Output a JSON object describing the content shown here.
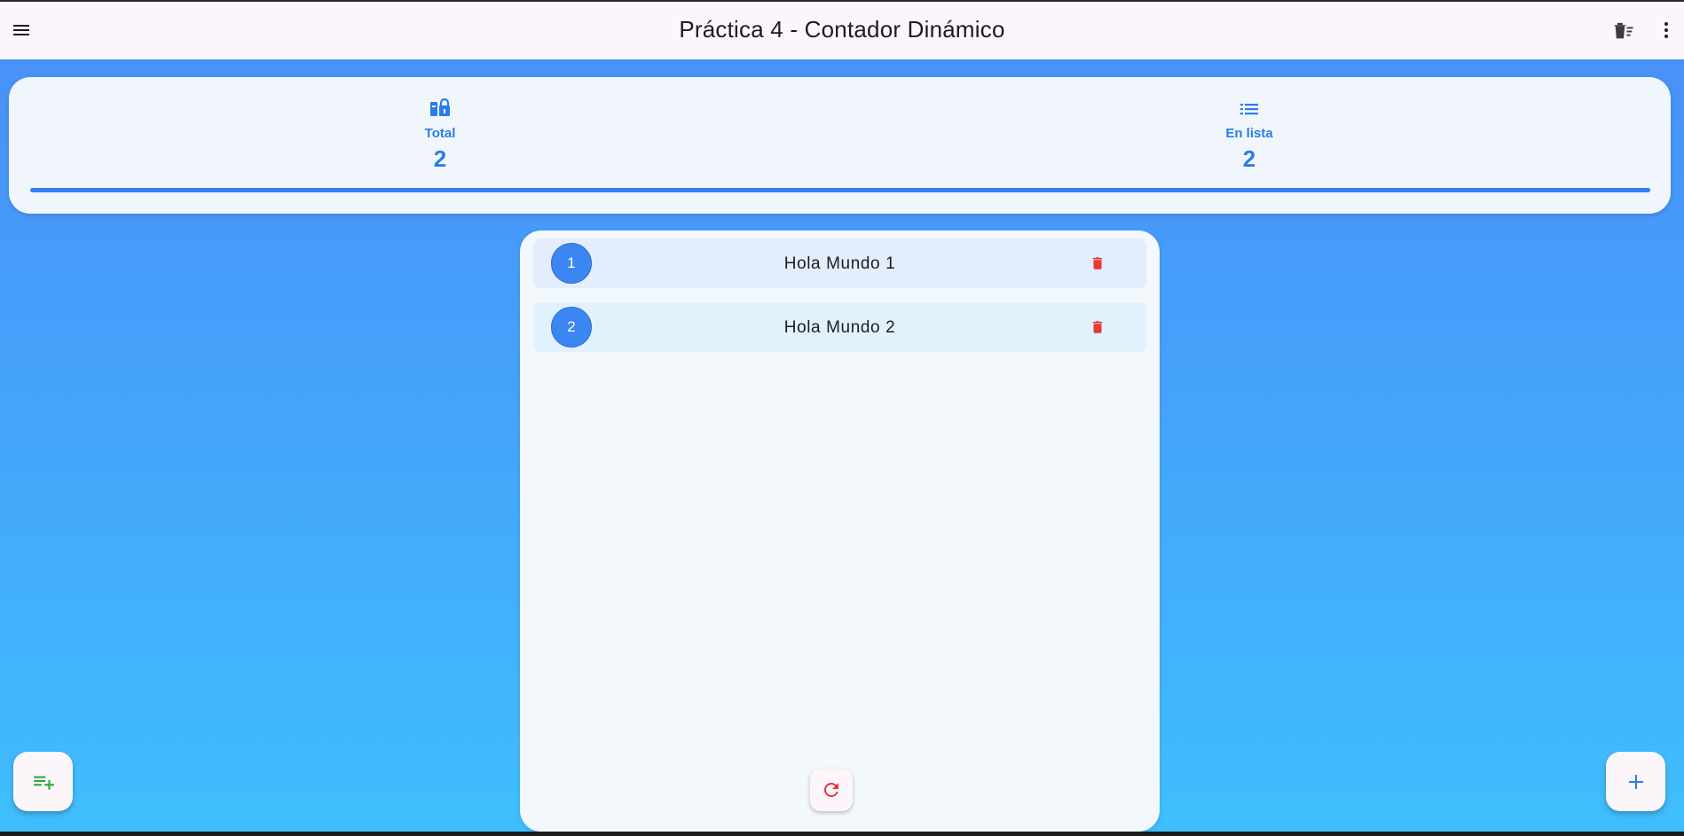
{
  "appbar": {
    "title": "Práctica 4 - Contador Dinámico",
    "menu_icon": "menu-icon",
    "clear_icon": "delete-sweep-icon",
    "more_icon": "more-vert-icon"
  },
  "stats": {
    "total": {
      "label": "Total",
      "value": "2",
      "icon": "counter-icon"
    },
    "in_list": {
      "label": "En lista",
      "value": "2",
      "icon": "list-icon"
    },
    "progress_fraction": 1.0
  },
  "list": {
    "items": [
      {
        "number": "1",
        "text": "Hola Mundo 1",
        "delete_icon": "delete-icon"
      },
      {
        "number": "2",
        "text": "Hola Mundo 2",
        "delete_icon": "delete-icon"
      }
    ],
    "reset_icon": "refresh-icon"
  },
  "fabs": {
    "left_icon": "playlist-add-icon",
    "right_icon": "add-icon"
  },
  "colors": {
    "accent": "#2c7ce8",
    "danger": "#e53935",
    "success": "#2eaa3f",
    "appbar_bg": "#fcf6fc",
    "bg_top": "#4a8ef7",
    "bg_bottom": "#3fbffd"
  }
}
